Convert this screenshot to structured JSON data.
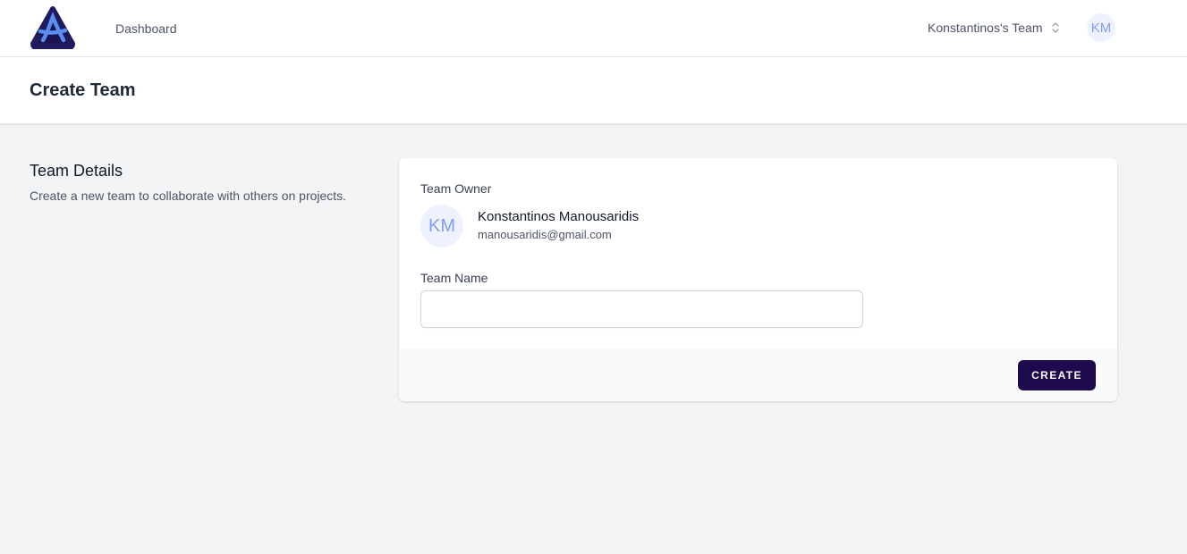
{
  "nav": {
    "logo": "app-logo",
    "links": [
      {
        "label": "Dashboard"
      }
    ],
    "team_switcher": {
      "label": "Konstantinos's Team",
      "icon": "chevron-up-down-icon"
    },
    "user_initials": "KM"
  },
  "header": {
    "title": "Create Team"
  },
  "section": {
    "title": "Team Details",
    "description": "Create a new team to collaborate with others on projects."
  },
  "form": {
    "owner_label": "Team Owner",
    "owner": {
      "initials": "KM",
      "name": "Konstantinos Manousaridis",
      "email": "manousaridis@gmail.com"
    },
    "team_name_label": "Team Name",
    "team_name_value": "",
    "team_name_placeholder": "",
    "submit_label": "CREATE"
  },
  "colors": {
    "brand_dark": "#1e0b4d",
    "logo_outline": "#2b2f8f",
    "logo_glow": "#5b8def",
    "avatar_bg": "#eef2ff",
    "avatar_text": "#7f9cf5",
    "page_bg": "#f3f4f6"
  }
}
